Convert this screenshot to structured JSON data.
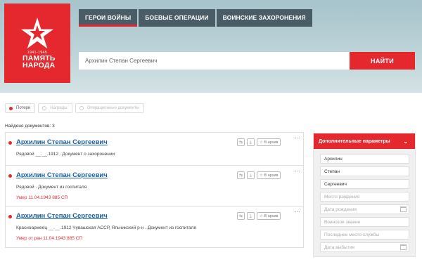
{
  "logo": {
    "years": "1941-1945",
    "line1": "ПАМЯТЬ",
    "line2": "НАРОДА"
  },
  "nav": {
    "tabs": [
      "ГЕРОИ ВОЙНЫ",
      "БОЕВЫЕ ОПЕРАЦИИ",
      "ВОИНСКИЕ ЗАХОРОНЕНИЯ"
    ],
    "active": 0
  },
  "search": {
    "value": "Архилин Степан Сергеевич",
    "button": "НАЙТИ"
  },
  "filters": [
    "Потери",
    "Награды",
    "Операционные документы"
  ],
  "found_text": "Найдено документов: 3",
  "results": [
    {
      "name": "Архилин Степан Сергеевич",
      "detail": "Рядовой __.__.1912 . Документ о захоронении",
      "death": ""
    },
    {
      "name": "Архилин Степан Сергеевич",
      "detail": "Рядовой . Документ из госпиталя",
      "death": "Умер 11.04.1943 885 СП"
    },
    {
      "name": "Архилин Степан Сергеевич",
      "detail": "Красноармеец __.__.1912 Чувашская АССР, Яльчикский р-н . Документ из госпиталя",
      "death": "Умер от ран 11.04.1943 885 СП"
    }
  ],
  "result_actions": {
    "archive_label": "В архив",
    "more": "···"
  },
  "panel": {
    "title": "Дополнительные параметры",
    "fields": [
      {
        "value": "Архилин",
        "placeholder": "",
        "calendar": false
      },
      {
        "value": "Степан",
        "placeholder": "",
        "calendar": false
      },
      {
        "value": "Сергеевич",
        "placeholder": "",
        "calendar": false
      },
      {
        "value": "",
        "placeholder": "Место рождения",
        "calendar": false
      },
      {
        "value": "",
        "placeholder": "Дата рождения",
        "calendar": true
      },
      {
        "value": "",
        "placeholder": "Воинское звание",
        "calendar": false
      },
      {
        "value": "",
        "placeholder": "Последнее место службы",
        "calendar": false
      },
      {
        "value": "",
        "placeholder": "Дата выбытия",
        "calendar": true
      }
    ]
  },
  "colors": {
    "accent": "#e5282e",
    "nav_bg": "#4a5d66",
    "link": "#1a5ea8"
  }
}
